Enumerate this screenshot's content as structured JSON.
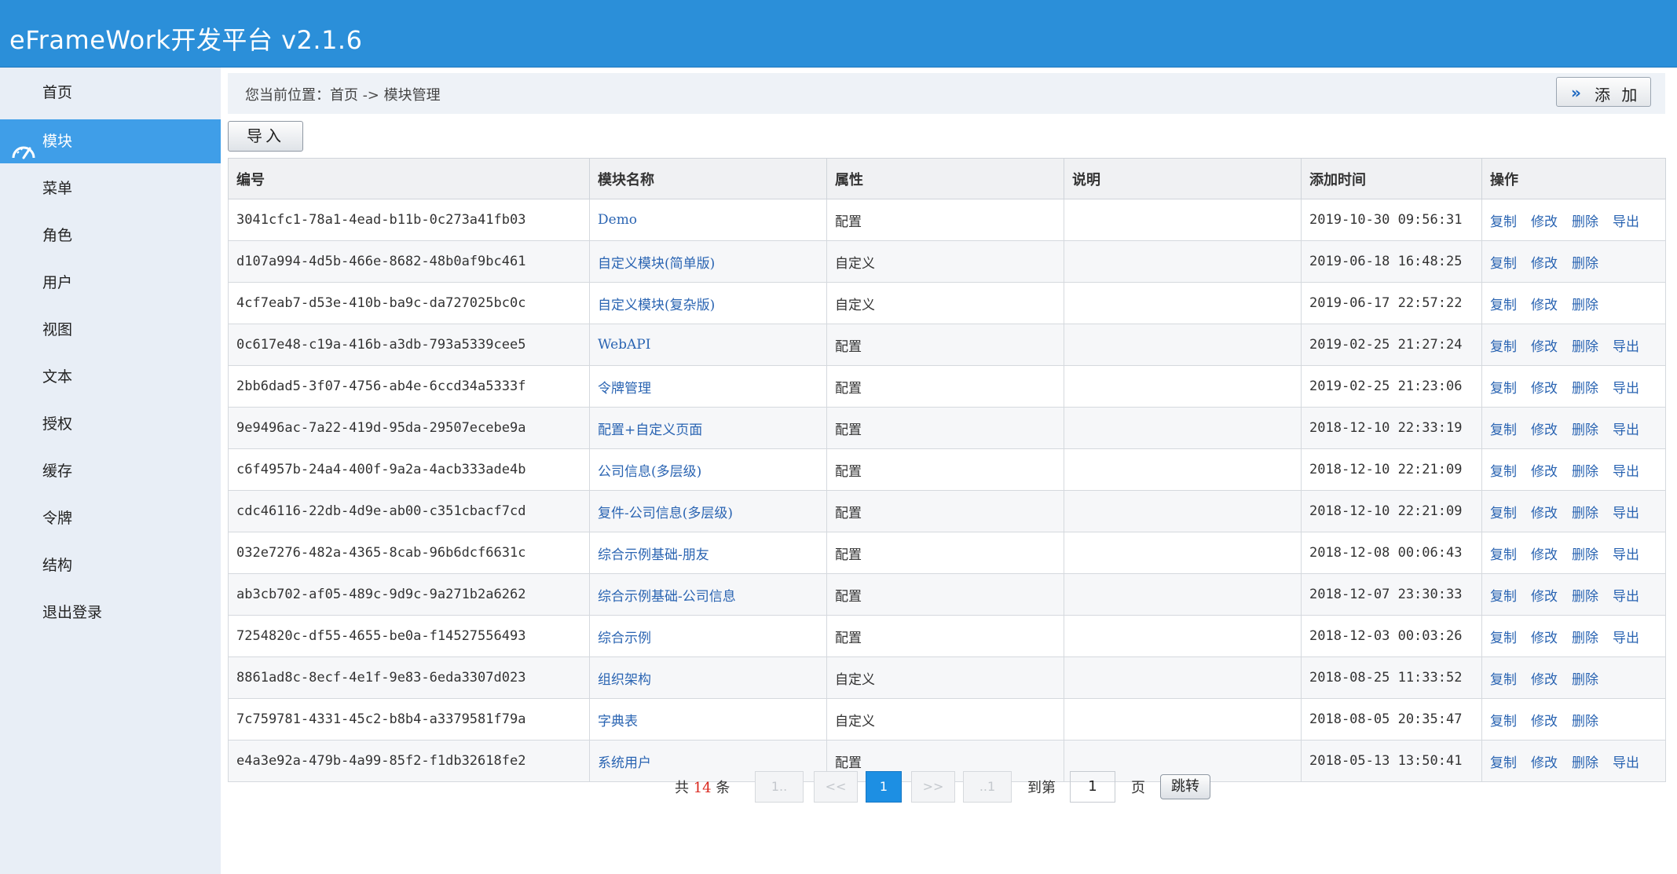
{
  "app": {
    "title": "eFrameWork开发平台 v2.1.6"
  },
  "sidebar": {
    "items": [
      {
        "label": "首页"
      },
      {
        "label": "模块",
        "active": true,
        "icon": "gauge-icon"
      },
      {
        "label": "菜单"
      },
      {
        "label": "角色"
      },
      {
        "label": "用户"
      },
      {
        "label": "视图"
      },
      {
        "label": "文本"
      },
      {
        "label": "授权"
      },
      {
        "label": "缓存"
      },
      {
        "label": "令牌"
      },
      {
        "label": "结构"
      },
      {
        "label": "退出登录"
      }
    ]
  },
  "breadcrumb": {
    "text": "您当前位置：首页 -> 模块管理"
  },
  "toolbar": {
    "add_label": "添 加",
    "add_icon": "double-chevron-right-icon",
    "import_label": "导入"
  },
  "table": {
    "columns": [
      "编号",
      "模块名称",
      "属性",
      "说明",
      "添加时间",
      "操作"
    ],
    "rows": [
      {
        "id": "3041cfc1-78a1-4ead-b11b-0c273a41fb03",
        "name": "Demo",
        "attr": "配置",
        "desc": "",
        "time": "2019-10-30 09:56:31",
        "ops": [
          "复制",
          "修改",
          "删除",
          "导出"
        ]
      },
      {
        "id": "d107a994-4d5b-466e-8682-48b0af9bc461",
        "name": "自定义模块(简单版)",
        "attr": "自定义",
        "desc": "",
        "time": "2019-06-18 16:48:25",
        "ops": [
          "复制",
          "修改",
          "删除"
        ]
      },
      {
        "id": "4cf7eab7-d53e-410b-ba9c-da727025bc0c",
        "name": "自定义模块(复杂版)",
        "attr": "自定义",
        "desc": "",
        "time": "2019-06-17 22:57:22",
        "ops": [
          "复制",
          "修改",
          "删除"
        ]
      },
      {
        "id": "0c617e48-c19a-416b-a3db-793a5339cee5",
        "name": "WebAPI",
        "attr": "配置",
        "desc": "",
        "time": "2019-02-25 21:27:24",
        "ops": [
          "复制",
          "修改",
          "删除",
          "导出"
        ]
      },
      {
        "id": "2bb6dad5-3f07-4756-ab4e-6ccd34a5333f",
        "name": "令牌管理",
        "attr": "配置",
        "desc": "",
        "time": "2019-02-25 21:23:06",
        "ops": [
          "复制",
          "修改",
          "删除",
          "导出"
        ]
      },
      {
        "id": "9e9496ac-7a22-419d-95da-29507ecebe9a",
        "name": "配置+自定义页面",
        "attr": "配置",
        "desc": "",
        "time": "2018-12-10 22:33:19",
        "ops": [
          "复制",
          "修改",
          "删除",
          "导出"
        ]
      },
      {
        "id": "c6f4957b-24a4-400f-9a2a-4acb333ade4b",
        "name": "公司信息(多层级)",
        "attr": "配置",
        "desc": "",
        "time": "2018-12-10 22:21:09",
        "ops": [
          "复制",
          "修改",
          "删除",
          "导出"
        ]
      },
      {
        "id": "cdc46116-22db-4d9e-ab00-c351cbacf7cd",
        "name": "复件-公司信息(多层级)",
        "attr": "配置",
        "desc": "",
        "time": "2018-12-10 22:21:09",
        "ops": [
          "复制",
          "修改",
          "删除",
          "导出"
        ]
      },
      {
        "id": "032e7276-482a-4365-8cab-96b6dcf6631c",
        "name": "综合示例基础-朋友",
        "attr": "配置",
        "desc": "",
        "time": "2018-12-08 00:06:43",
        "ops": [
          "复制",
          "修改",
          "删除",
          "导出"
        ]
      },
      {
        "id": "ab3cb702-af05-489c-9d9c-9a271b2a6262",
        "name": "综合示例基础-公司信息",
        "attr": "配置",
        "desc": "",
        "time": "2018-12-07 23:30:33",
        "ops": [
          "复制",
          "修改",
          "删除",
          "导出"
        ]
      },
      {
        "id": "7254820c-df55-4655-be0a-f14527556493",
        "name": "综合示例",
        "attr": "配置",
        "desc": "",
        "time": "2018-12-03 00:03:26",
        "ops": [
          "复制",
          "修改",
          "删除",
          "导出"
        ]
      },
      {
        "id": "8861ad8c-8ecf-4e1f-9e83-6eda3307d023",
        "name": "组织架构",
        "attr": "自定义",
        "desc": "",
        "time": "2018-08-25 11:33:52",
        "ops": [
          "复制",
          "修改",
          "删除"
        ]
      },
      {
        "id": "7c759781-4331-45c2-b8b4-a3379581f79a",
        "name": "字典表",
        "attr": "自定义",
        "desc": "",
        "time": "2018-08-05 20:35:47",
        "ops": [
          "复制",
          "修改",
          "删除"
        ]
      },
      {
        "id": "e4a3e92a-479b-4a99-85f2-f1db32618fe2",
        "name": "系统用户",
        "attr": "配置",
        "desc": "",
        "time": "2018-05-13 13:50:41",
        "ops": [
          "复制",
          "修改",
          "删除",
          "导出"
        ]
      }
    ]
  },
  "pagination": {
    "total_prefix": "共",
    "total_count": "14",
    "total_suffix": "条",
    "first": "1..",
    "prev": "<<",
    "current": "1",
    "next": ">>",
    "last": "..1",
    "goto_prefix": "到第",
    "page_value": "1",
    "goto_suffix": "页",
    "jump_label": "跳转"
  },
  "colors": {
    "header": "#2b8fd9",
    "sidebar_active": "#3f9ee8",
    "link": "#2a64b2",
    "count": "#d9261c",
    "current_page": "#1d8fe3"
  }
}
